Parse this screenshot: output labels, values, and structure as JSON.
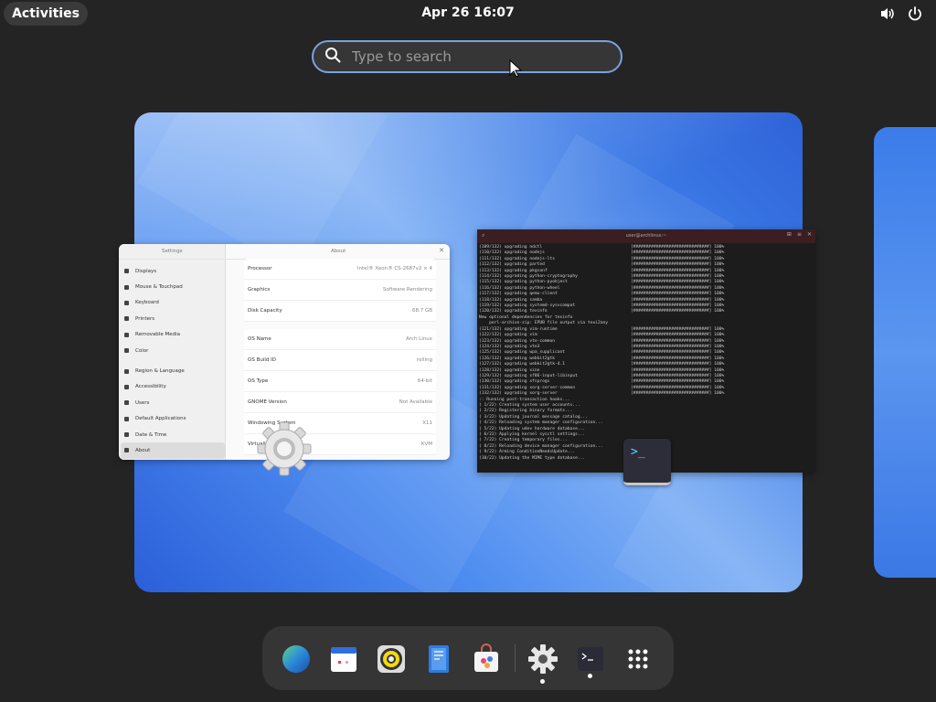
{
  "topbar": {
    "activities_label": "Activities",
    "clock": "Apr 26  16:07",
    "icons": [
      "volume-icon",
      "power-icon"
    ]
  },
  "search": {
    "placeholder": "Type to search",
    "value": ""
  },
  "settings_window": {
    "sidebar_title": "Settings",
    "main_title": "About",
    "sidebar_items": [
      {
        "label": "Displays",
        "icon": "display-icon"
      },
      {
        "label": "Mouse & Touchpad",
        "icon": "mouse-icon"
      },
      {
        "label": "Keyboard",
        "icon": "keyboard-icon"
      },
      {
        "label": "Printers",
        "icon": "printer-icon"
      },
      {
        "label": "Removable Media",
        "icon": "media-icon"
      },
      {
        "label": "Color",
        "icon": "color-icon"
      },
      {
        "label": "Region & Language",
        "icon": "flag-icon"
      },
      {
        "label": "Accessibility",
        "icon": "accessibility-icon"
      },
      {
        "label": "Users",
        "icon": "users-icon"
      },
      {
        "label": "Default Applications",
        "icon": "star-icon"
      },
      {
        "label": "Date & Time",
        "icon": "clock-icon"
      },
      {
        "label": "About",
        "icon": "info-icon"
      }
    ],
    "hardware_rows": [
      {
        "label": "Processor",
        "value": "Intel® Xeon® CS-2687v2 × 4"
      },
      {
        "label": "Graphics",
        "value": "Software Rendering"
      },
      {
        "label": "Disk Capacity",
        "value": "68.7 GB"
      }
    ],
    "os_rows": [
      {
        "label": "OS Name",
        "value": "Arch Linux"
      },
      {
        "label": "OS Build ID",
        "value": "rolling"
      },
      {
        "label": "OS Type",
        "value": "64-bit"
      },
      {
        "label": "GNOME Version",
        "value": "Not Available"
      },
      {
        "label": "Windowing System",
        "value": "X11"
      },
      {
        "label": "Virtualization",
        "value": "KVM"
      }
    ]
  },
  "terminal_window": {
    "title": "user@archlinux:~",
    "lines": [
      "(109/132) upgrading ndctl                                   [##############################] 100%",
      "(110/132) upgrading nodejs                                  [##############################] 100%",
      "(111/132) upgrading nodejs-lts                              [##############################] 100%",
      "(112/132) upgrading parted                                  [##############################] 100%",
      "(113/132) upgrading pkgconf                                 [##############################] 100%",
      "(114/132) upgrading python-cryptography                     [##############################] 100%",
      "(115/132) upgrading python-pyobject                         [##############################] 100%",
      "(116/132) upgrading python-wheel                            [##############################] 100%",
      "(117/132) upgrading qemu-client                             [##############################] 100%",
      "(118/132) upgrading samba                                   [##############################] 100%",
      "(119/132) upgrading systemd-sysvcompat                      [##############################] 100%",
      "(120/132) upgrading texinfo                                 [##############################] 100%",
      "New optional dependencies for texinfo",
      "    perl-archive-zip: EPUB file output via texi2any",
      "(121/132) upgrading vim-runtime                             [##############################] 100%",
      "(122/132) upgrading vim                                     [##############################] 100%",
      "(123/132) upgrading vte-common                              [##############################] 100%",
      "(124/132) upgrading vte3                                    [##############################] 100%",
      "(125/132) upgrading wpa_supplicant                          [##############################] 100%",
      "(126/132) upgrading webkit2gtk                              [##############################] 100%",
      "(127/132) upgrading webkit2gtk-4.1                          [##############################] 100%",
      "(128/132) upgrading xine                                    [##############################] 100%",
      "(129/132) upgrading xf86-input-libinput                     [##############################] 100%",
      "(130/132) upgrading xfsprogs                                [##############################] 100%",
      "(131/132) upgrading xorg-server-common                      [##############################] 100%",
      "(132/132) upgrading xorg-server                             [##############################] 100%",
      ":: Running post-transaction hooks...",
      "( 1/22) Creating system user accounts...",
      "( 2/22) Registering binary formats...",
      "( 3/22) Updating journal message catalog...",
      "( 4/22) Reloading system manager configuration...",
      "( 5/22) Updating udev hardware database...",
      "( 6/22) Applying kernel sysctl settings...",
      "( 7/22) Creating temporary files...",
      "( 8/22) Reloading device manager configuration...",
      "( 9/22) Arming ConditionNeedsUpdate...",
      "(10/22) Updating the MIME type database..."
    ]
  },
  "term_glyph": ">_",
  "dash": {
    "apps": [
      {
        "name": "web-browser-icon",
        "running": false
      },
      {
        "name": "calendar-icon",
        "running": false
      },
      {
        "name": "rhythmbox-icon",
        "running": false
      },
      {
        "name": "text-editor-icon",
        "running": false
      },
      {
        "name": "software-store-icon",
        "running": false
      },
      {
        "name": "settings-icon",
        "running": true
      },
      {
        "name": "terminal-icon",
        "running": true
      },
      {
        "name": "show-apps-icon",
        "running": false
      }
    ]
  },
  "colors": {
    "accent": "#7aa2e3",
    "panel": "#242424",
    "dash": "#353535",
    "terminal_titlebar": "#3b1e22"
  }
}
